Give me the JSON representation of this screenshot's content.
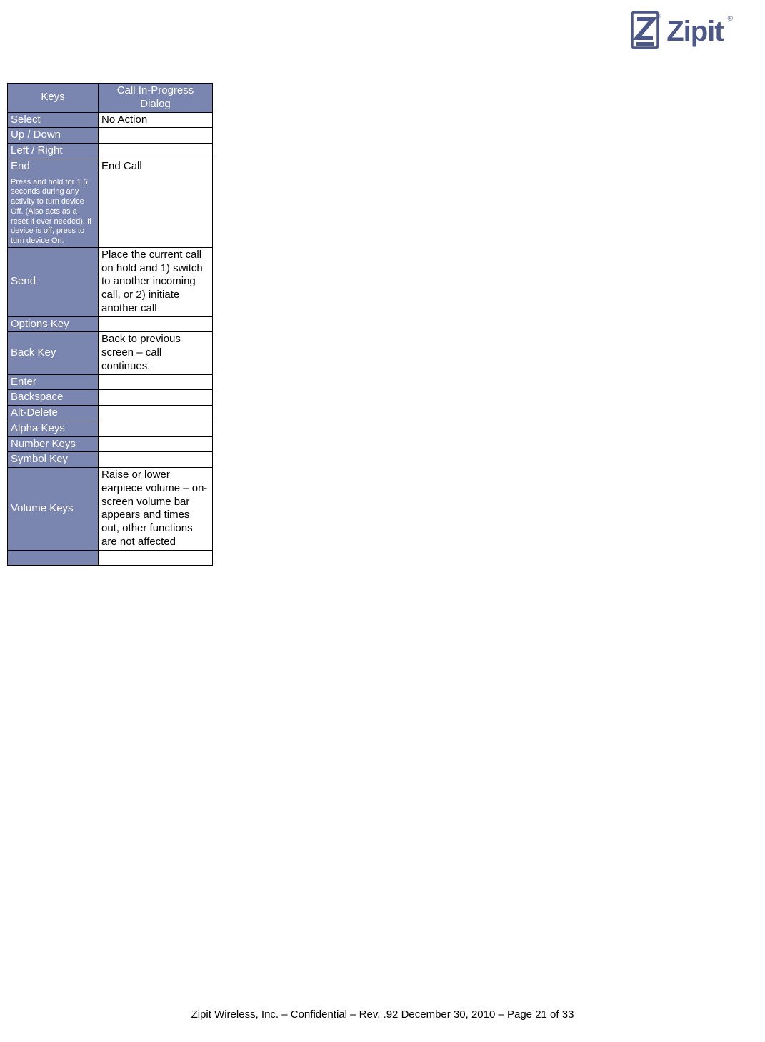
{
  "brand": {
    "name": "Zipit",
    "registered": "®"
  },
  "table": {
    "headers": {
      "col1": "Keys",
      "col2": "Call In-Progress Dialog"
    },
    "rows": [
      {
        "key": "Select",
        "note": "",
        "value": "No Action"
      },
      {
        "key": "Up / Down",
        "note": "",
        "value": ""
      },
      {
        "key": "Left / Right",
        "note": "",
        "value": ""
      },
      {
        "key": "End",
        "note": "Press and hold for 1.5 seconds during any activity to turn device Off.  (Also acts as a reset if ever needed).  If device is off, press to turn device On.",
        "value": "End Call"
      },
      {
        "key": "Send",
        "note": "",
        "value": "Place the current call on hold and 1) switch to another incoming call, or 2) initiate another call"
      },
      {
        "key": "Options Key",
        "note": "",
        "value": ""
      },
      {
        "key": "Back Key",
        "note": "",
        "value": "Back to previous screen – call continues."
      },
      {
        "key": "Enter",
        "note": "",
        "value": ""
      },
      {
        "key": "Backspace",
        "note": "",
        "value": ""
      },
      {
        "key": "Alt-Delete",
        "note": "",
        "value": ""
      },
      {
        "key": "Alpha Keys",
        "note": "",
        "value": ""
      },
      {
        "key": "Number Keys",
        "note": "",
        "value": ""
      },
      {
        "key": "Symbol Key",
        "note": "",
        "value": ""
      },
      {
        "key": "Volume Keys",
        "note": "",
        "value": "Raise or lower earpiece volume – on-screen volume bar appears and times out, other functions are not affected"
      },
      {
        "key": "",
        "note": "",
        "value": ""
      }
    ]
  },
  "footer": {
    "text": "Zipit Wireless, Inc. – Confidential – Rev. .92 December 30, 2010 – Page 21 of 33"
  }
}
